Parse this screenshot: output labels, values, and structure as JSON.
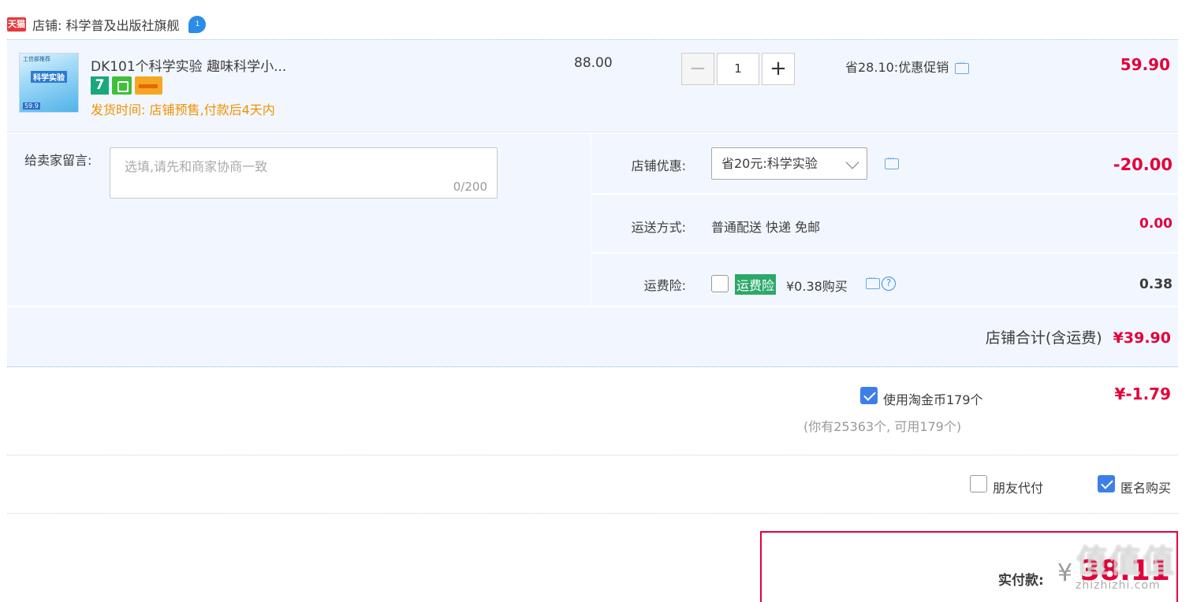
{
  "shop": {
    "badge": "天猫",
    "label": "店铺: 科学普及出版社旗舰",
    "chat_badge": "1"
  },
  "item": {
    "thumb_top": "工信部推荐",
    "thumb_title": "科学实验",
    "thumb_price": "59.9",
    "title": "DK101个科学实验 趣味科学小...",
    "badge_7": "7",
    "ship_time": "发货时间: 店铺预售,付款后4天内",
    "original_price": "88.00",
    "quantity": "1",
    "qty_minus": "−",
    "qty_plus": "+",
    "promo": "省28.10:优惠促销",
    "price": "59.90"
  },
  "message": {
    "label": "给卖家留言:",
    "placeholder": "选填,请先和商家协商一致",
    "counter": "0/200"
  },
  "options": {
    "coupon_label": "店铺优惠:",
    "coupon_value": "省20元:科学实验",
    "coupon_amount": "-20.00",
    "shipping_label": "运送方式:",
    "shipping_value": "普通配送 快递 免邮",
    "shipping_amount": "0.00",
    "insurance_label": "运费险:",
    "insurance_tag": "运费险",
    "insurance_text": "¥0.38购买",
    "insurance_help": "?",
    "insurance_amount": "0.38"
  },
  "totals": {
    "shop_total_label": "店铺合计(含运费)",
    "shop_total_value": "¥39.90"
  },
  "taojinbi": {
    "label": "使用淘金币179个",
    "sub": "(你有25363个, 可用179个)",
    "amount": "¥-1.79",
    "checked": true
  },
  "pay_options": {
    "friend_pay": "朋友代付",
    "anonymous": "匿名购买"
  },
  "final": {
    "label": "实付款:",
    "currency": "¥",
    "amount": "38.11"
  },
  "watermark": {
    "main": "值值值",
    "sub": "zhizhizhi.com"
  },
  "colors": {
    "price_red": "#e4003a",
    "panel_bg": "#f2f7ff",
    "ship_orange": "#f29100",
    "check_blue": "#3d7fe8"
  }
}
